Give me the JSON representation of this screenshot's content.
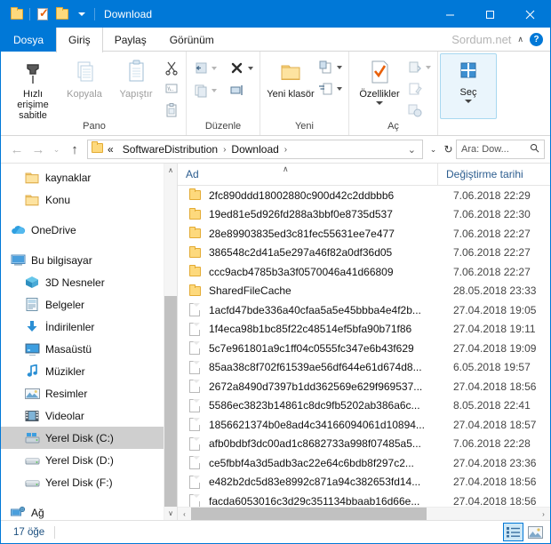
{
  "window": {
    "title": "Download",
    "minimize_label": "─",
    "maximize_label": "☐",
    "close_label": "✕"
  },
  "quick_access": [
    {
      "name": "folder-icon"
    },
    {
      "name": "properties-icon"
    },
    {
      "name": "new-folder-icon"
    },
    {
      "name": "customize-dropdown"
    }
  ],
  "ribbon": {
    "tabs": [
      {
        "label": "Dosya",
        "id": "file"
      },
      {
        "label": "Giriş",
        "id": "home"
      },
      {
        "label": "Paylaş",
        "id": "share"
      },
      {
        "label": "Görünüm",
        "id": "view"
      }
    ],
    "watermark": "Sordum.net",
    "collapse_label": "∧",
    "help_label": "?",
    "groups": [
      {
        "label": "Pano",
        "buttons": [
          {
            "label": "Hızlı erişime\nsabitle",
            "icon": "pin-icon"
          },
          {
            "label": "Kopyala",
            "icon": "copy-icon"
          },
          {
            "label": "Yapıştır",
            "icon": "paste-icon"
          }
        ],
        "small": [
          {
            "icon": "cut-icon"
          },
          {
            "icon": "copy-path-icon"
          },
          {
            "icon": "paste-shortcut-icon"
          }
        ]
      },
      {
        "label": "Düzenle",
        "small": [
          {
            "icon": "move-to-icon"
          },
          {
            "icon": "delete-icon"
          },
          {
            "icon": "copy-to-icon"
          },
          {
            "icon": "rename-icon"
          }
        ]
      },
      {
        "label": "Yeni",
        "buttons": [
          {
            "label": "Yeni\nklasör",
            "icon": "new-folder-icon"
          }
        ],
        "small": [
          {
            "icon": "new-item-icon"
          },
          {
            "icon": "easy-access-icon"
          }
        ]
      },
      {
        "label": "Aç",
        "buttons": [
          {
            "label": "Özellikler",
            "icon": "properties-icon"
          }
        ],
        "small": [
          {
            "icon": "open-icon"
          },
          {
            "icon": "edit-icon"
          },
          {
            "icon": "history-icon"
          }
        ]
      },
      {
        "label": "",
        "buttons": [
          {
            "label": "Seç",
            "icon": "select-icon"
          }
        ]
      }
    ]
  },
  "address_bar": {
    "back_label": "←",
    "forward_label": "→",
    "recent_label": "⌄",
    "up_label": "↑",
    "crumb_overflow": "«",
    "crumbs": [
      "SoftwareDistribution",
      "Download"
    ],
    "crumb_sep": "›",
    "history_label": "⌄",
    "refresh_label": "↻",
    "search_placeholder": "Ara: Dow...",
    "search_icon_label": "🔍"
  },
  "sidebar": {
    "items": [
      {
        "label": "kaynaklar",
        "icon": "folder-icon",
        "indent": 1,
        "selected": false
      },
      {
        "label": "Konu",
        "icon": "folder-icon",
        "indent": 1,
        "selected": false
      },
      {
        "label": "",
        "icon": "spacer",
        "indent": 0,
        "selected": false
      },
      {
        "label": "OneDrive",
        "icon": "onedrive-icon",
        "indent": 0,
        "selected": false
      },
      {
        "label": "",
        "icon": "spacer",
        "indent": 0,
        "selected": false
      },
      {
        "label": "Bu bilgisayar",
        "icon": "this-pc-icon",
        "indent": 0,
        "selected": false
      },
      {
        "label": "3D Nesneler",
        "icon": "3d-objects-icon",
        "indent": 1,
        "selected": false
      },
      {
        "label": "Belgeler",
        "icon": "documents-icon",
        "indent": 1,
        "selected": false
      },
      {
        "label": "İndirilenler",
        "icon": "downloads-icon",
        "indent": 1,
        "selected": false
      },
      {
        "label": "Masaüstü",
        "icon": "desktop-icon",
        "indent": 1,
        "selected": false
      },
      {
        "label": "Müzikler",
        "icon": "music-icon",
        "indent": 1,
        "selected": false
      },
      {
        "label": "Resimler",
        "icon": "pictures-icon",
        "indent": 1,
        "selected": false
      },
      {
        "label": "Videolar",
        "icon": "videos-icon",
        "indent": 1,
        "selected": false
      },
      {
        "label": "Yerel Disk (C:)",
        "icon": "local-disk-c-icon",
        "indent": 1,
        "selected": true
      },
      {
        "label": "Yerel Disk (D:)",
        "icon": "local-disk-icon",
        "indent": 1,
        "selected": false
      },
      {
        "label": "Yerel Disk (F:)",
        "icon": "local-disk-icon",
        "indent": 1,
        "selected": false
      },
      {
        "label": "",
        "icon": "spacer",
        "indent": 0,
        "selected": false
      },
      {
        "label": "Ağ",
        "icon": "network-icon",
        "indent": 0,
        "selected": false
      }
    ],
    "scroll_up_label": "∧",
    "scroll_down_label": "∨"
  },
  "file_list": {
    "columns": [
      {
        "label": "Ad",
        "sorted": true,
        "sort_indicator": "∧"
      },
      {
        "label": "Değiştirme tarihi",
        "sorted": false
      }
    ],
    "rows": [
      {
        "name": "2fc890ddd18002880c900d42c2ddbbb6",
        "date": "7.06.2018 22:29",
        "type": "folder"
      },
      {
        "name": "19ed81e5d926fd288a3bbf0e8735d537",
        "date": "7.06.2018 22:30",
        "type": "folder"
      },
      {
        "name": "28e89903835ed3c81fec55631ee7e477",
        "date": "7.06.2018 22:27",
        "type": "folder"
      },
      {
        "name": "386548c2d41a5e297a46f82a0df36d05",
        "date": "7.06.2018 22:27",
        "type": "folder"
      },
      {
        "name": "ccc9acb4785b3a3f0570046a41d66809",
        "date": "7.06.2018 22:27",
        "type": "folder"
      },
      {
        "name": "SharedFileCache",
        "date": "28.05.2018 23:33",
        "type": "folder"
      },
      {
        "name": "1acfd47bde336a40cfaa5a5e45bbba4e4f2b...",
        "date": "27.04.2018 19:05",
        "type": "file"
      },
      {
        "name": "1f4eca98b1bc85f22c48514ef5bfa90b71f86",
        "date": "27.04.2018 19:11",
        "type": "file"
      },
      {
        "name": "5c7e961801a9c1ff04c0555fc347e6b43f629",
        "date": "27.04.2018 19:09",
        "type": "file"
      },
      {
        "name": "85aa38c8f702f61539ae56df644e61d674d8...",
        "date": "6.05.2018 19:57",
        "type": "file"
      },
      {
        "name": "2672a8490d7397b1dd362569e629f969537...",
        "date": "27.04.2018 18:56",
        "type": "file"
      },
      {
        "name": "5586ec3823b14861c8dc9fb5202ab386a6c...",
        "date": "8.05.2018 22:41",
        "type": "file"
      },
      {
        "name": "1856621374b0e8ad4c34166094061d10894...",
        "date": "27.04.2018 18:57",
        "type": "file"
      },
      {
        "name": "afb0bdbf3dc00ad1c8682733a998f07485a5...",
        "date": "7.06.2018 22:28",
        "type": "file"
      },
      {
        "name": "ce5fbbf4a3d5adb3ac22e64c6bdb8f297c2...",
        "date": "27.04.2018 23:36",
        "type": "file"
      },
      {
        "name": "e482b2dc5d83e8992c871a94c382653fd14...",
        "date": "27.04.2018 18:56",
        "type": "file"
      },
      {
        "name": "facda6053016c3d29c351134bbaab16d66e...",
        "date": "27.04.2018 18:56",
        "type": "file"
      }
    ],
    "hscroll_left_label": "‹",
    "hscroll_right_label": "›"
  },
  "status_bar": {
    "item_count": "17 öğe",
    "views": [
      {
        "name": "details-view",
        "active": true
      },
      {
        "name": "large-icons-view",
        "active": false
      }
    ]
  }
}
